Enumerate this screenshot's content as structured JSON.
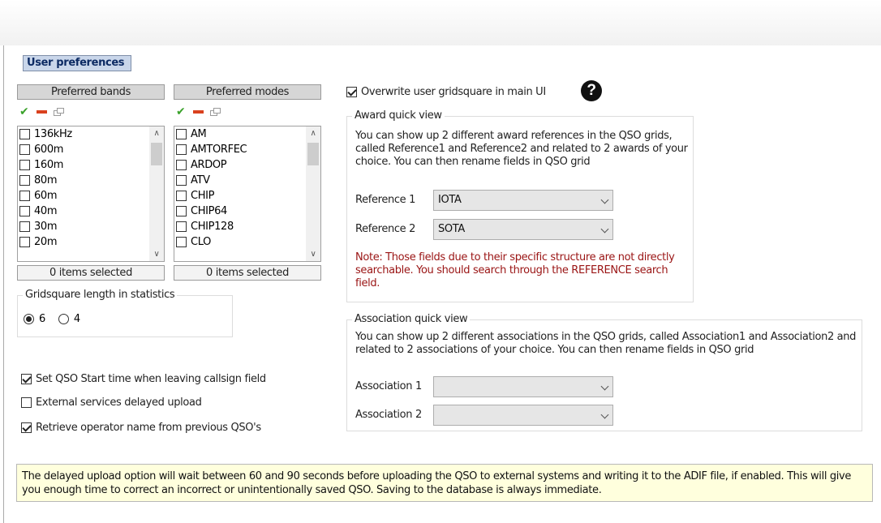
{
  "section_title": "User preferences",
  "bands": {
    "header": "Preferred bands",
    "items": [
      "136kHz",
      "600m",
      "160m",
      "80m",
      "60m",
      "40m",
      "30m",
      "20m"
    ],
    "footer": "0 items selected"
  },
  "modes": {
    "header": "Preferred modes",
    "items": [
      "AM",
      "AMTORFEC",
      "ARDOP",
      "ATV",
      "CHIP",
      "CHIP64",
      "CHIP128",
      "CLO"
    ],
    "footer": "0 items selected"
  },
  "gridsquare": {
    "legend": "Gridsquare length in statistics",
    "options": [
      "6",
      "4"
    ],
    "selected": "6"
  },
  "checks": {
    "qso_start": "Set QSO Start time when leaving callsign field",
    "delayed_upload": "External services delayed upload",
    "retrieve_name": "Retrieve operator name from previous QSO's",
    "overwrite_grid": "Overwrite user gridsquare in main UI"
  },
  "help_icon": "?",
  "award": {
    "legend": "Award quick view",
    "description": "You can show up 2 different award references in the QSO grids, called Reference1 and Reference2 and related to 2 awards of your choice. You can then rename fields in QSO grid",
    "ref1_label": "Reference 1",
    "ref1_value": "IOTA",
    "ref2_label": "Reference 2",
    "ref2_value": "SOTA",
    "note": "Note: Those fields due to their specific structure are not directly searchable. You should search through the REFERENCE search field."
  },
  "association": {
    "legend": "Association quick view",
    "description": "You can show up 2 different associations in the QSO grids, called Association1 and Association2 and related to 2 associations of your choice. You can then rename fields in QSO grid",
    "assoc1_label": "Association 1",
    "assoc1_value": "",
    "assoc2_label": "Association 2",
    "assoc2_value": ""
  },
  "info_text": "The delayed upload option will wait between 60 and 90 seconds before uploading the QSO to external systems and writing it to the ADIF file, if enabled. This will give you enough time to correct an incorrect or unintentionally saved QSO. Saving to the database is always immediate.",
  "colors": {
    "note": "#9a1414",
    "info_bg": "#ffffdd",
    "title_bg": "#c9d6ea"
  }
}
